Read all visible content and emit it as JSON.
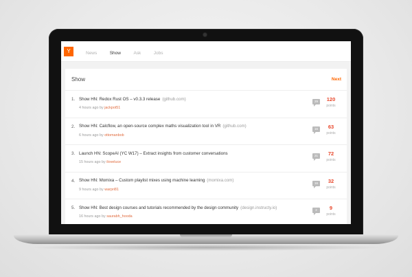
{
  "nav": {
    "logo": "Y",
    "items": [
      {
        "label": "News",
        "active": false
      },
      {
        "label": "Show",
        "active": true
      },
      {
        "label": "Ask",
        "active": false
      },
      {
        "label": "Jobs",
        "active": false
      }
    ]
  },
  "section": {
    "title": "Show",
    "next_label": "Next"
  },
  "meta_by": "by",
  "points_label": "points",
  "items": [
    {
      "rank": "1.",
      "title": "Show HN: Redox Rust OS – v0.3.3 release",
      "domain": "(github.com)",
      "time": "4 hours ago",
      "user": "jackpot51",
      "comments": "29",
      "points": "120"
    },
    {
      "rank": "2.",
      "title": "Show HN: Calcflow, an open-source complex maths visualization tool in VR",
      "domain": "(github.com)",
      "time": "6 hours ago",
      "user": "ottomanbob",
      "comments": "16",
      "points": "63"
    },
    {
      "rank": "3.",
      "title": "Launch HN: ScopeAI (YC W17) – Extract insights from customer conversations",
      "domain": "",
      "time": "15 hours ago",
      "user": "iloveluce",
      "comments": "21",
      "points": "72"
    },
    {
      "rank": "4.",
      "title": "Show HN: Momixa – Custom playlist mixes using machine learning",
      "domain": "(momixa.com)",
      "time": "9 hours ago",
      "user": "warpri81",
      "comments": "16",
      "points": "32"
    },
    {
      "rank": "5.",
      "title": "Show HN: Best design courses and tutorials recommended by the design community",
      "domain": "(design.instructy.io)",
      "time": "16 hours ago",
      "user": "saurabh_hooda",
      "comments": "2",
      "points": "9"
    }
  ]
}
